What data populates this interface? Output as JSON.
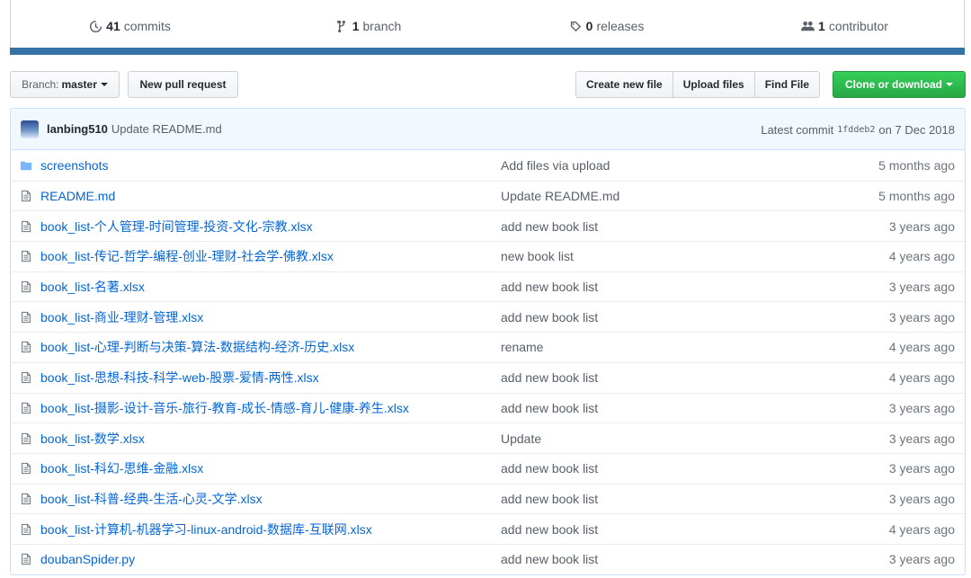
{
  "stats": {
    "commits": {
      "count": "41",
      "label": "commits",
      "icon": "history-icon"
    },
    "branches": {
      "count": "1",
      "label": "branch",
      "icon": "branch-icon"
    },
    "releases": {
      "count": "0",
      "label": "releases",
      "icon": "tag-icon"
    },
    "contributors": {
      "count": "1",
      "label": "contributor",
      "icon": "people-icon"
    }
  },
  "language_color": "#3572A5",
  "toolbar": {
    "branch_prefix": "Branch:",
    "branch_name": "master",
    "new_pull_request": "New pull request",
    "create_new_file": "Create new file",
    "upload_files": "Upload files",
    "find_file": "Find File",
    "clone_or_download": "Clone or download"
  },
  "commit_tease": {
    "author": "lanbing510",
    "message": "Update README.md",
    "latest_label": "Latest commit",
    "sha": "1fddeb2",
    "date": "on 7 Dec 2018"
  },
  "files": [
    {
      "type": "dir",
      "name": "screenshots",
      "message": "Add files via upload",
      "age": "5 months ago"
    },
    {
      "type": "file",
      "name": "README.md",
      "message": "Update README.md",
      "age": "5 months ago"
    },
    {
      "type": "file",
      "name": "book_list-个人管理-时间管理-投资-文化-宗教.xlsx",
      "message": "add new book list",
      "age": "3 years ago"
    },
    {
      "type": "file",
      "name": "book_list-传记-哲学-编程-创业-理财-社会学-佛教.xlsx",
      "message": "new book list",
      "age": "4 years ago"
    },
    {
      "type": "file",
      "name": "book_list-名著.xlsx",
      "message": "add new book list",
      "age": "3 years ago"
    },
    {
      "type": "file",
      "name": "book_list-商业-理财-管理.xlsx",
      "message": "add new book list",
      "age": "3 years ago"
    },
    {
      "type": "file",
      "name": "book_list-心理-判断与决策-算法-数据结构-经济-历史.xlsx",
      "message": "rename",
      "age": "4 years ago"
    },
    {
      "type": "file",
      "name": "book_list-思想-科技-科学-web-股票-爱情-两性.xlsx",
      "message": "add new book list",
      "age": "4 years ago"
    },
    {
      "type": "file",
      "name": "book_list-摄影-设计-音乐-旅行-教育-成长-情感-育儿-健康-养生.xlsx",
      "message": "add new book list",
      "age": "3 years ago"
    },
    {
      "type": "file",
      "name": "book_list-数学.xlsx",
      "message": "Update",
      "age": "3 years ago"
    },
    {
      "type": "file",
      "name": "book_list-科幻-思维-金融.xlsx",
      "message": "add new book list",
      "age": "3 years ago"
    },
    {
      "type": "file",
      "name": "book_list-科普-经典-生活-心灵-文学.xlsx",
      "message": "add new book list",
      "age": "3 years ago"
    },
    {
      "type": "file",
      "name": "book_list-计算机-机器学习-linux-android-数据库-互联网.xlsx",
      "message": "add new book list",
      "age": "4 years ago"
    },
    {
      "type": "file",
      "name": "doubanSpider.py",
      "message": "add new book list",
      "age": "3 years ago"
    }
  ]
}
